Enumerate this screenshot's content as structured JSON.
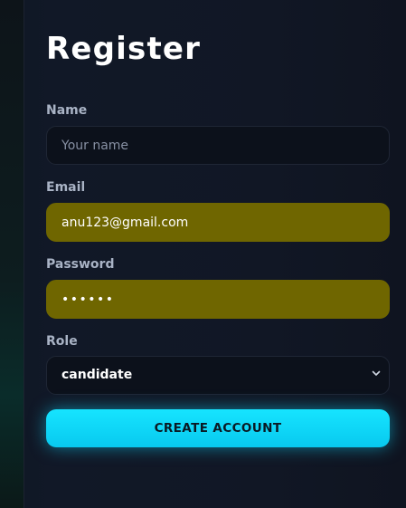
{
  "form": {
    "title": "Register",
    "name": {
      "label": "Name",
      "placeholder": "Your name",
      "value": ""
    },
    "email": {
      "label": "Email",
      "value": "anu123@gmail.com"
    },
    "password": {
      "label": "Password",
      "value": "••••••"
    },
    "role": {
      "label": "Role",
      "value": "candidate"
    },
    "submit_label": "CREATE ACCOUNT"
  },
  "colors": {
    "accent": "#0fd7f8",
    "autofill": "#6f6600",
    "field_bg": "#0c111b",
    "label": "#a9b3c5"
  },
  "icons": {
    "role_select": "chevron-down-icon"
  }
}
